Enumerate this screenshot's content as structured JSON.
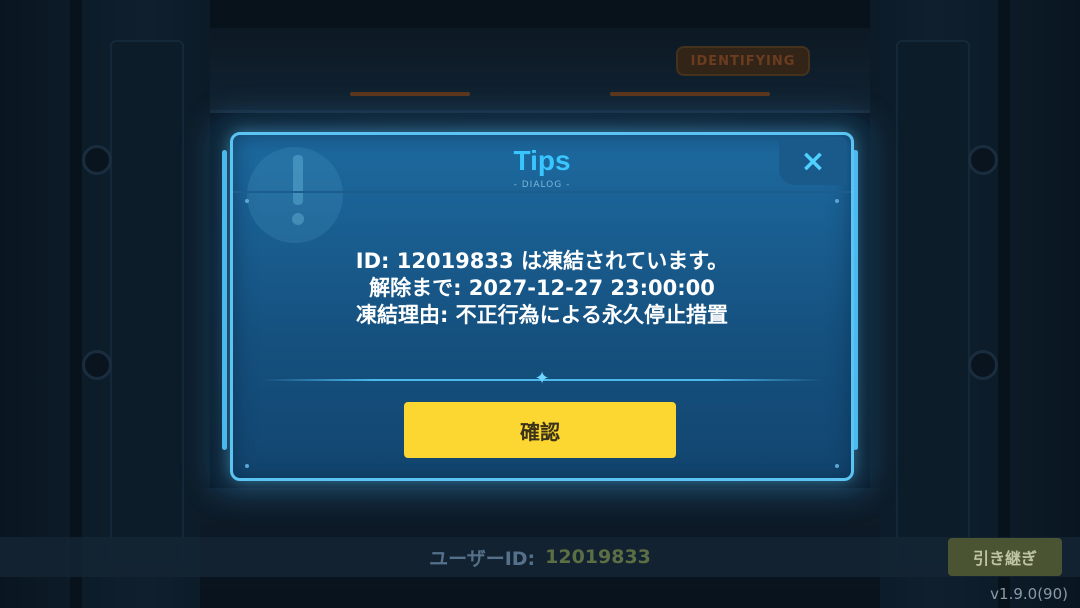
{
  "scene": {
    "id_plate_text": "IDENTIFYING"
  },
  "dialog": {
    "title": "Tips",
    "subtitle": "- DIALOG -",
    "close_icon": "×",
    "message_lines": [
      "ID: 12019833 は凍結されています。",
      "解除まで: 2027-12-27 23:00:00",
      "凍結理由: 不正行為による永久停止措置"
    ],
    "divider_icon": "✦",
    "confirm_label": "確認"
  },
  "footer": {
    "user_id_label": "ユーザーID:",
    "user_id_value": "12019833",
    "handover_label": "引き継ぎ",
    "version": "v1.9.0(90)"
  },
  "colors": {
    "title": "#39c6ff",
    "dialog_border": "#5cc4f2",
    "confirm_button": "#fcd631"
  },
  "icons": {
    "close": "close-icon",
    "divider": "sparkle-icon",
    "warning": "exclamation-icon"
  }
}
